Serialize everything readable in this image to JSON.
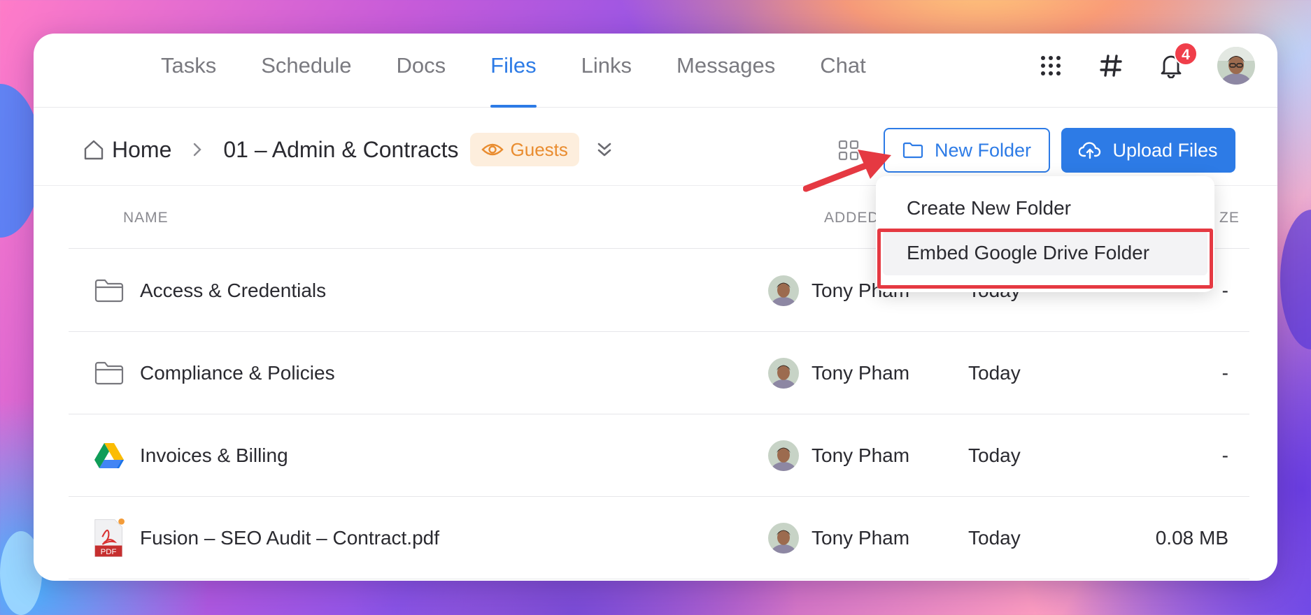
{
  "nav": {
    "tabs": [
      {
        "label": "Tasks"
      },
      {
        "label": "Schedule"
      },
      {
        "label": "Docs"
      },
      {
        "label": "Files",
        "active": true
      },
      {
        "label": "Links"
      },
      {
        "label": "Messages"
      },
      {
        "label": "Chat"
      }
    ],
    "notifications_count": "4",
    "icons": [
      "apps-grid-icon",
      "hashtag-icon",
      "bell-icon",
      "avatar"
    ]
  },
  "breadcrumb": {
    "home_label": "Home",
    "current_folder": "01 – Admin & Contracts",
    "visibility_badge": "Guests"
  },
  "toolbar": {
    "new_folder_label": "New Folder",
    "upload_label": "Upload Files"
  },
  "dropdown": {
    "items": [
      {
        "label": "Create New Folder"
      },
      {
        "label": "Embed Google Drive Folder",
        "highlighted": true
      }
    ]
  },
  "table": {
    "headers": {
      "name": "NAME",
      "added_by": "ADDED BY",
      "size_partial": "ZE"
    },
    "rows": [
      {
        "icon": "folder-icon",
        "name": "Access & Credentials",
        "added_by": "Tony Pham",
        "date": "Today",
        "size": "-"
      },
      {
        "icon": "folder-icon",
        "name": "Compliance & Policies",
        "added_by": "Tony Pham",
        "date": "Today",
        "size": "-"
      },
      {
        "icon": "google-drive-icon",
        "name": "Invoices & Billing",
        "added_by": "Tony Pham",
        "date": "Today",
        "size": "-"
      },
      {
        "icon": "pdf-file-icon",
        "name": "Fusion – SEO Audit – Contract.pdf",
        "added_by": "Tony Pham",
        "date": "Today",
        "size": "0.08 MB"
      }
    ]
  },
  "pdf_icon_label": "PDF",
  "colors": {
    "accent": "#2d7be6",
    "badge_red": "#f03e4a",
    "guests_bg": "#fdeedd",
    "guests_text": "#e98c2f",
    "annotation_red": "#e53942"
  }
}
